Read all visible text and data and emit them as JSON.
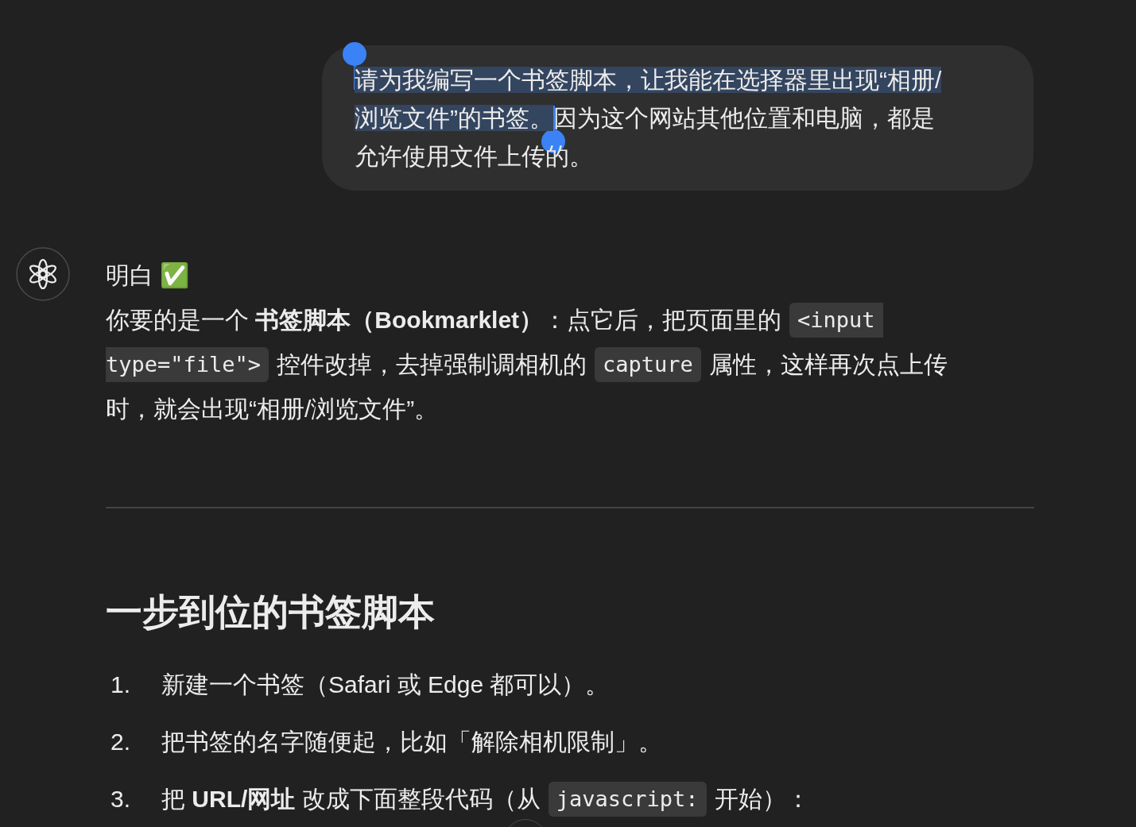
{
  "user_message": {
    "lines": [
      [
        {
          "text": "请为我编写一个书签脚本，让我能在选择器里出现“相册/",
          "selected": true
        }
      ],
      [
        {
          "text": "浏览文件”的书签。",
          "selected": true
        },
        {
          "text": "因为这个网站其他位置和电脑，都是",
          "selected": false
        }
      ],
      [
        {
          "text": "允许使用文件上传的。",
          "selected": false
        }
      ]
    ]
  },
  "assistant": {
    "intro": "明白 ✅",
    "paragraph_lines": [
      [
        {
          "kind": "text",
          "text": "你要的是一个 **书签脚本（Bookmarklet）**：点它后，把页面里的"
        },
        {
          "kind": "code",
          "text": "<input"
        }
      ],
      [
        {
          "kind": "code",
          "text": "type=\"file\">"
        },
        {
          "kind": "text",
          "text": "控件改掉，去掉强制调相机的"
        },
        {
          "kind": "code",
          "text": "capture"
        },
        {
          "kind": "text",
          "text": "属性，这样再次点上传"
        }
      ],
      [
        {
          "kind": "text",
          "text": "时，就会出现“相册/浏览文件”。"
        }
      ]
    ],
    "heading": "一步到位的书签脚本",
    "steps": [
      {
        "number": "1.",
        "parts": [
          {
            "kind": "text",
            "text": "新建一个书签（Safari 或 Edge 都可以）。"
          }
        ]
      },
      {
        "number": "2.",
        "parts": [
          {
            "kind": "text",
            "text": "把书签的名字随便起，比如「解除相机限制」。"
          }
        ]
      },
      {
        "number": "3.",
        "parts": [
          {
            "kind": "text",
            "text": "把 **URL/网址** 改成下面整段代码（从"
          },
          {
            "kind": "code",
            "text": "javascript:"
          },
          {
            "kind": "text",
            "text": "开始）："
          }
        ]
      }
    ]
  }
}
